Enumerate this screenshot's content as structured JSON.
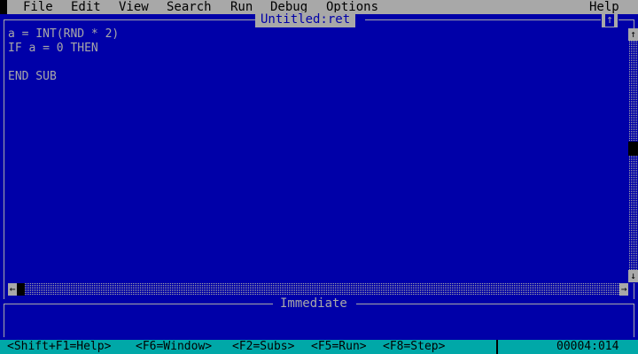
{
  "menu": {
    "items": [
      "File",
      "Edit",
      "View",
      "Search",
      "Run",
      "Debug",
      "Options"
    ],
    "help": "Help"
  },
  "editor": {
    "title": "Untitled:ret",
    "maximize_glyph": "↑",
    "lines": [
      "a = INT(RND * 2)",
      "IF a = 0 THEN",
      "",
      "END SUB"
    ]
  },
  "scrollbars": {
    "up_arrow": "↑",
    "down_arrow": "↓",
    "left_arrow": "←",
    "right_arrow": "→"
  },
  "immediate": {
    "title": "Immediate"
  },
  "status": {
    "keys": [
      "<Shift+F1=Help>",
      "<F6=Window>",
      "<F2=Subs>",
      "<F5=Run>",
      "<F8=Step>"
    ],
    "position": "00004:014"
  },
  "colors": {
    "background": "#0000a8",
    "foreground": "#a8a8a8",
    "statusbar": "#00a8a8"
  }
}
